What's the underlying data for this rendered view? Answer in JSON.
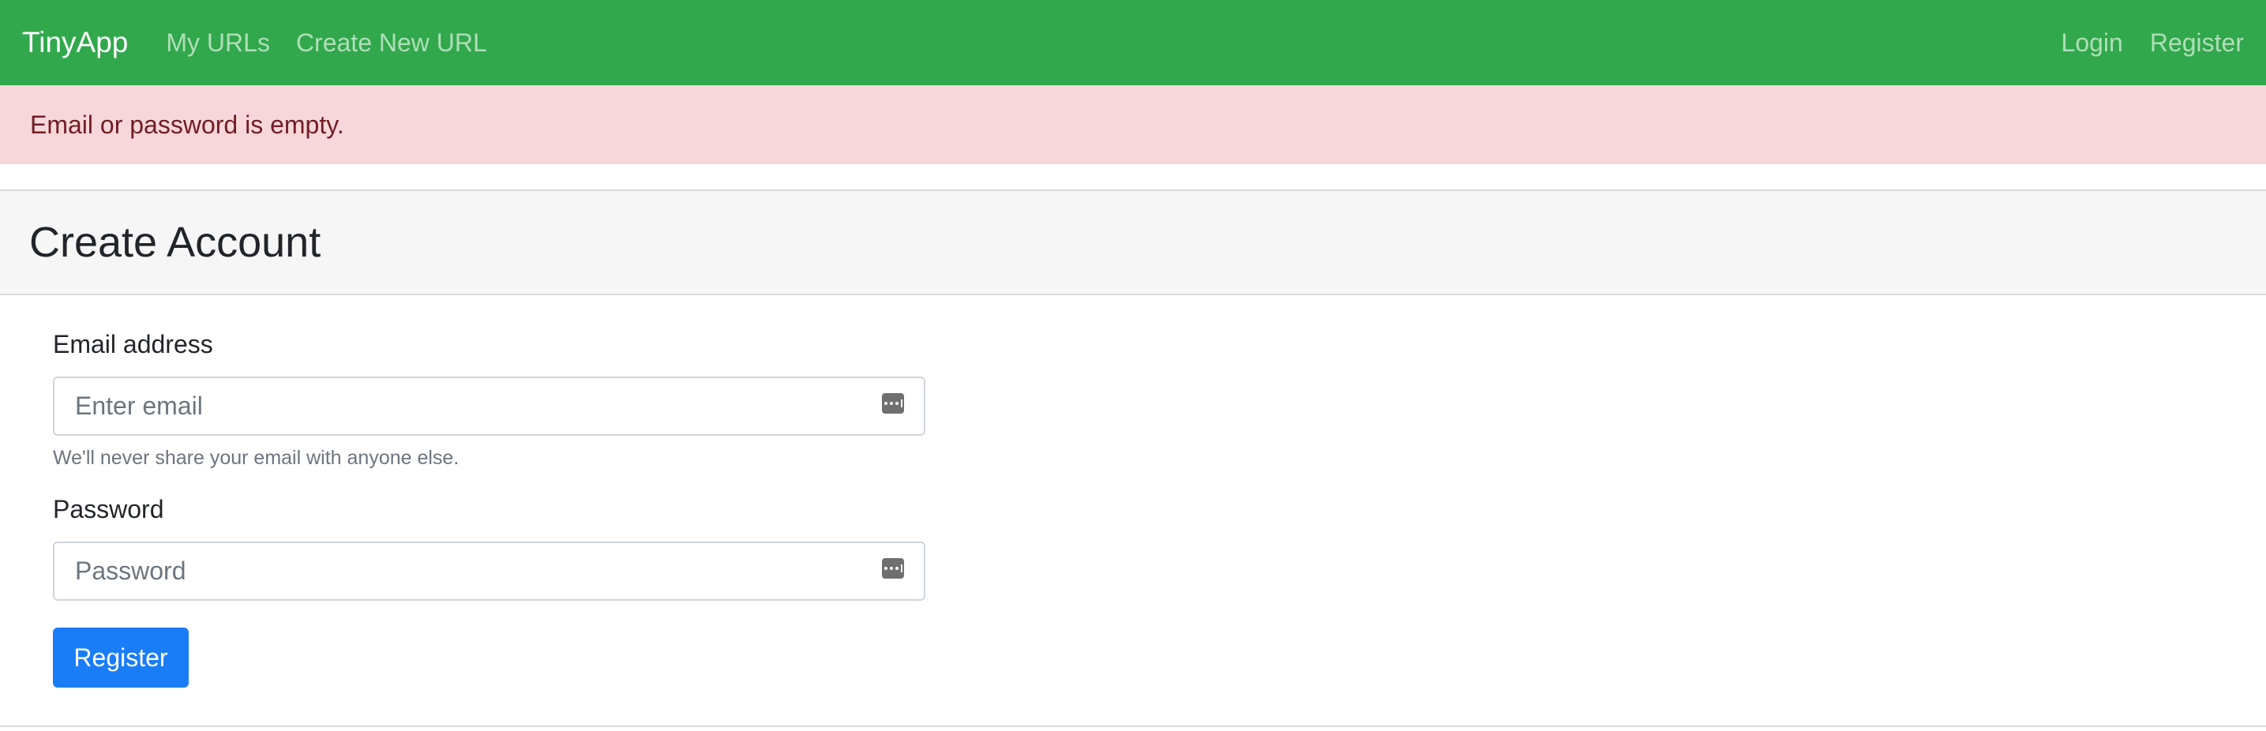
{
  "navbar": {
    "brand": "TinyApp",
    "links": [
      "My URLs",
      "Create New URL"
    ],
    "right_links": [
      "Login",
      "Register"
    ],
    "background_color": "#31a84b"
  },
  "alert": {
    "message": "Email or password is empty.",
    "background_color": "#f7d7da",
    "text_color": "#721c24"
  },
  "card": {
    "title": "Create Account",
    "email": {
      "label": "Email address",
      "placeholder": "Enter email",
      "value": "",
      "help": "We'll never share your email with anyone else.",
      "icon": "password-manager-icon"
    },
    "password": {
      "label": "Password",
      "placeholder": "Password",
      "value": "",
      "icon": "password-manager-icon"
    },
    "submit_label": "Register",
    "submit_color": "#1a7df8"
  }
}
